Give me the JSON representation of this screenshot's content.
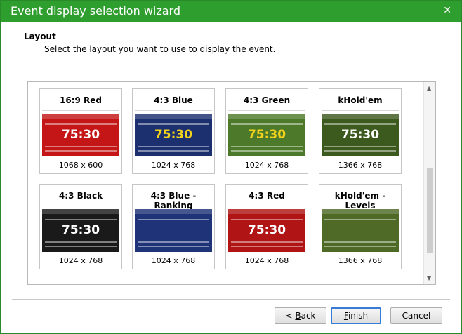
{
  "window": {
    "title": "Event display selection wizard"
  },
  "header": {
    "title": "Layout",
    "subtitle": "Select the layout you want to use to display the event."
  },
  "layouts": [
    {
      "name": "16:9 Red",
      "resolution": "1068 x 600",
      "clock": "75:30",
      "bg": "#c41616",
      "clock_color": "#ffffff"
    },
    {
      "name": "4:3 Blue",
      "resolution": "1024 x 768",
      "clock": "75:30",
      "bg": "#1c2f6e",
      "clock_color": "#f2d21c"
    },
    {
      "name": "4:3 Green",
      "resolution": "1024 x 768",
      "clock": "75:30",
      "bg": "#4d7a2a",
      "clock_color": "#f2d21c"
    },
    {
      "name": "kHold'em",
      "resolution": "1366 x 768",
      "clock": "75:30",
      "bg": "#3c5a1e",
      "clock_color": "#ffffff"
    },
    {
      "name": "4:3 Black",
      "resolution": "1024 x 768",
      "clock": "75:30",
      "bg": "#1a1a1a",
      "clock_color": "#ffffff"
    },
    {
      "name": "4:3 Blue - Ranking",
      "resolution": "1024 x 768",
      "clock": "",
      "bg": "#1e3378",
      "clock_color": "#ffffff"
    },
    {
      "name": "4:3 Red",
      "resolution": "1024 x 768",
      "clock": "75:30",
      "bg": "#b01414",
      "clock_color": "#ffffff"
    },
    {
      "name": "kHold'em - Levels",
      "resolution": "1366 x 768",
      "clock": "",
      "bg": "#4e6a26",
      "clock_color": "#ffffff"
    }
  ],
  "buttons": {
    "back": {
      "prefix": "< ",
      "hotkey": "B",
      "rest": "ack"
    },
    "finish": {
      "hotkey": "F",
      "rest": "inish"
    },
    "cancel": "Cancel"
  },
  "icons": {
    "close": "close-icon",
    "scroll_up": "scroll-up-arrow-icon",
    "scroll_down": "scroll-down-arrow-icon"
  }
}
